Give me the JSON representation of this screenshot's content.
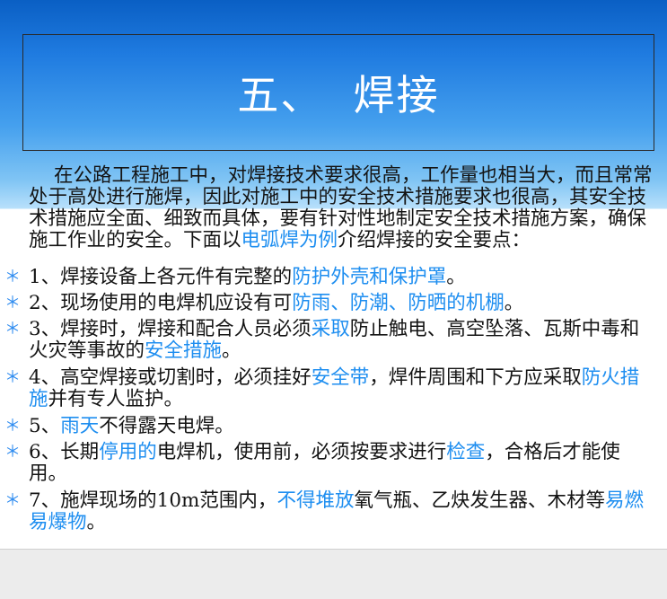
{
  "title": "五、  焊接",
  "intro": [
    {
      "text": "在公路工程施工中，对焊接技术要求很高，工作量也相当大，而且常常处于高处进行施焊，因此对施工中的安全技术措施要求也很高，其安全技术措施应全面、细致而具体，要有针对性地制定安全技术措施方案，确保施工作业的安全。下面以",
      "hl": false
    },
    {
      "text": "电弧焊为例",
      "hl": true
    },
    {
      "text": "介绍焊接的安全要点：",
      "hl": false
    }
  ],
  "bullet_symbol": "＊",
  "colors": {
    "highlight": "#1e8ef0",
    "bullet": "#2f8cf0",
    "text": "#141414",
    "title": "#ffffff"
  },
  "bullets": [
    {
      "segments": [
        {
          "text": "1、焊接设备上各元件有完整的",
          "hl": false
        },
        {
          "text": "防护外壳和保护罩",
          "hl": true
        },
        {
          "text": "。",
          "hl": false
        }
      ]
    },
    {
      "segments": [
        {
          "text": "2、现场使用的电焊机应设有可",
          "hl": false
        },
        {
          "text": "防雨、防潮、防晒的机棚",
          "hl": true
        },
        {
          "text": "。",
          "hl": false
        }
      ]
    },
    {
      "segments": [
        {
          "text": "3、焊接时，焊接和配合人员必须",
          "hl": false
        },
        {
          "text": "采取",
          "hl": true
        },
        {
          "text": "防止触电、高空坠落、瓦斯中毒和火灾等事故的",
          "hl": false
        },
        {
          "text": "安全措施",
          "hl": true
        },
        {
          "text": "。",
          "hl": false
        }
      ]
    },
    {
      "segments": [
        {
          "text": "4、高空焊接或切割时，必须挂好",
          "hl": false
        },
        {
          "text": "安全带",
          "hl": true
        },
        {
          "text": "，焊件周围和下方应采取",
          "hl": false
        },
        {
          "text": "防火措施",
          "hl": true
        },
        {
          "text": "并有专人监护。",
          "hl": false
        }
      ]
    },
    {
      "segments": [
        {
          "text": "5、",
          "hl": false
        },
        {
          "text": "雨天",
          "hl": true
        },
        {
          "text": "不得露天电焊。",
          "hl": false
        }
      ]
    },
    {
      "segments": [
        {
          "text": "6、长期",
          "hl": false
        },
        {
          "text": "停用的",
          "hl": true
        },
        {
          "text": "电焊机，使用前，必须按要求进行",
          "hl": false
        },
        {
          "text": "检查",
          "hl": true
        },
        {
          "text": "，合格后才能使用。",
          "hl": false
        }
      ]
    },
    {
      "segments": [
        {
          "text": "7、施焊现场的10m范围内，",
          "hl": false
        },
        {
          "text": "不得堆放",
          "hl": true
        },
        {
          "text": "氧气瓶、乙炔发生器、木材等",
          "hl": false
        },
        {
          "text": "易燃易爆物",
          "hl": true
        },
        {
          "text": "。",
          "hl": false
        }
      ]
    }
  ]
}
